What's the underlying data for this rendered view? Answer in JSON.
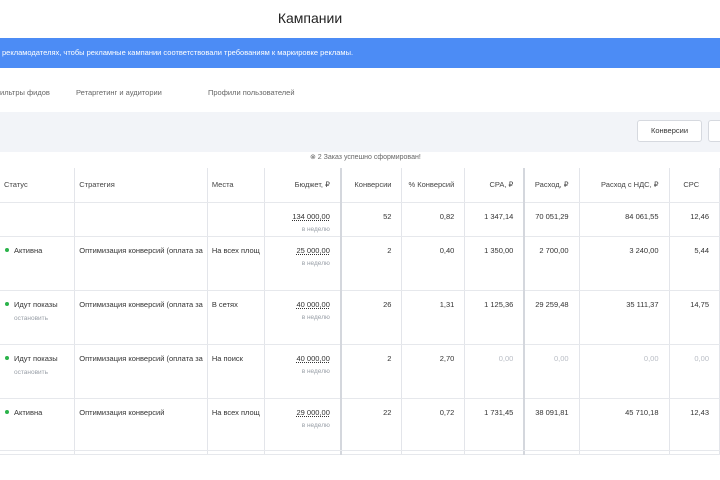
{
  "header": {
    "title": "Кампании"
  },
  "banner": {
    "text": "рекламодателях, чтобы рекламные кампании соответствовали требованиям к маркировке рекламы."
  },
  "tabs": [
    {
      "label": "ильтры фидов"
    },
    {
      "label": "Ретаргетинг и аудитории"
    },
    {
      "label": "Профили пользователей"
    }
  ],
  "toolbar": {
    "conversions_label": "Конверсии"
  },
  "notice": {
    "text": "⊗ 2 Заказ успешно сформирован!"
  },
  "table": {
    "columns": [
      "Статус",
      "Стратегия",
      "Места",
      "Бюджет, ₽",
      "Конверсии",
      "% Конверсий",
      "CPA, ₽",
      "Расход, ₽",
      "Расход с НДС, ₽",
      "CPC"
    ],
    "totals": {
      "budget": "134 000,00",
      "budget_period": "в неделю",
      "conversions": "52",
      "conv_rate": "0,82",
      "cpa": "1 347,14",
      "spend": "70 051,29",
      "spend_vat": "84 061,55",
      "cpc": "12,46"
    },
    "rows": [
      {
        "status": "Активна",
        "status_sub": "",
        "strategy": "Оптимизация конверсий (оплата за",
        "places": "На всех площ",
        "budget": "25 000,00",
        "budget_period": "в неделю",
        "conversions": "2",
        "conv_rate": "0,40",
        "cpa": "1 350,00",
        "spend": "2 700,00",
        "spend_vat": "3 240,00",
        "cpc": "5,44"
      },
      {
        "status": "Идут показы",
        "status_sub": "остановить",
        "strategy": "Оптимизация конверсий (оплата за",
        "places": "В сетях",
        "budget": "40 000,00",
        "budget_period": "в неделю",
        "conversions": "26",
        "conv_rate": "1,31",
        "cpa": "1 125,36",
        "spend": "29 259,48",
        "spend_vat": "35 111,37",
        "cpc": "14,75"
      },
      {
        "status": "Идут показы",
        "status_sub": "остановить",
        "strategy": "Оптимизация конверсий (оплата за",
        "places": "На поиск",
        "budget": "40 000,00",
        "budget_period": "в неделю",
        "conversions": "2",
        "conv_rate": "2,70",
        "cpa": "0,00",
        "spend": "0,00",
        "spend_vat": "0,00",
        "cpc": "0,00"
      },
      {
        "status": "Активна",
        "status_sub": "",
        "strategy": "Оптимизация конверсий",
        "places": "На всех площ",
        "budget": "29 000,00",
        "budget_period": "в неделю",
        "conversions": "22",
        "conv_rate": "0,72",
        "cpa": "1 731,45",
        "spend": "38 091,81",
        "spend_vat": "45 710,18",
        "cpc": "12,43"
      }
    ]
  },
  "colors": {
    "banner_bg": "#4c8cf5",
    "toolbar_bg": "#f2f4f8",
    "status_active": "#2bb34a",
    "muted_text": "#b9bdc5"
  }
}
